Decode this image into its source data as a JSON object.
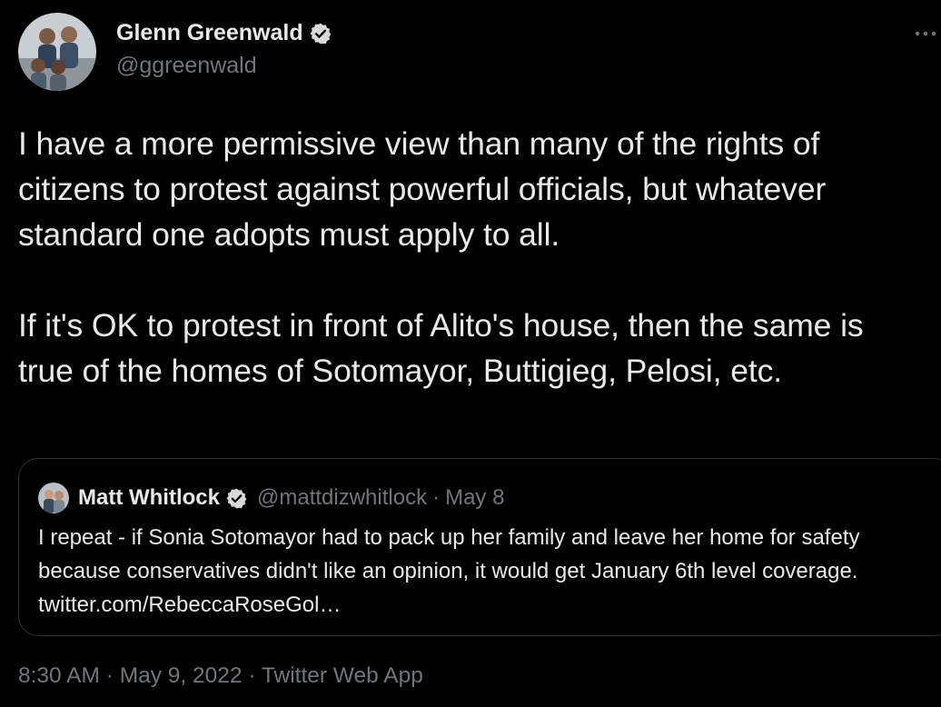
{
  "author": {
    "name": "Glenn Greenwald",
    "handle": "@ggreenwald",
    "verified_icon": "verified-badge-icon"
  },
  "menu": {
    "more_label": "···"
  },
  "tweet": {
    "paragraph_1": "I have a more permissive view than many of the rights of citizens to protest against powerful officials, but whatever standard one adopts must apply to all.",
    "paragraph_2": "If it's OK to protest in front of Alito's house, then the same is true of the homes of Sotomayor, Buttigieg, Pelosi, etc."
  },
  "quote": {
    "name": "Matt Whitlock",
    "handle": "@mattdizwhitlock",
    "separator": "·",
    "date": "May 8",
    "text": "I repeat - if Sonia Sotomayor had to pack up her family and leave her home for safety because conservatives didn't like an opinion, it would get January 6th level coverage. twitter.com/RebeccaRoseGol…"
  },
  "meta": {
    "time": "8:30 AM",
    "sep1": "·",
    "date": "May 9, 2022",
    "sep2": "·",
    "source": "Twitter Web App"
  },
  "colors": {
    "background": "#000000",
    "text_primary": "#e7e9ea",
    "text_secondary": "#71767b",
    "border": "#2f3336",
    "verified_badge": "#d9d9d9"
  }
}
